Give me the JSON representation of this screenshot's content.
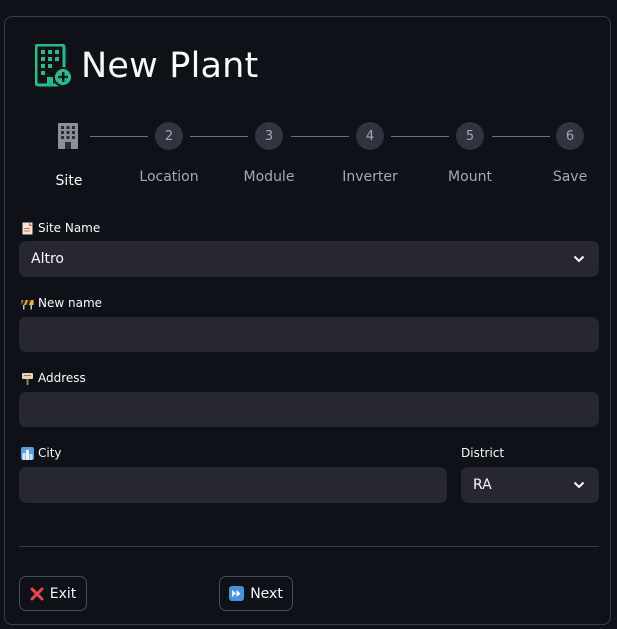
{
  "header": {
    "title": "New Plant",
    "icon": "building-add-icon"
  },
  "stepper": {
    "steps": [
      {
        "number": "",
        "label": "Site",
        "active": true,
        "icon": "building-icon"
      },
      {
        "number": "2",
        "label": "Location"
      },
      {
        "number": "3",
        "label": "Module"
      },
      {
        "number": "4",
        "label": "Inverter"
      },
      {
        "number": "5",
        "label": "Mount"
      },
      {
        "number": "6",
        "label": "Save"
      }
    ]
  },
  "form": {
    "site_name": {
      "label": "Site Name",
      "value": "Altro",
      "icon": "page-icon"
    },
    "new_name": {
      "label": "New name",
      "value": "",
      "icon": "construction-icon"
    },
    "address": {
      "label": "Address",
      "value": "",
      "icon": "signpost-icon"
    },
    "city": {
      "label": "City",
      "value": "",
      "icon": "cityscape-icon"
    },
    "district": {
      "label": "District",
      "value": "RA"
    }
  },
  "buttons": {
    "exit": {
      "label": "Exit",
      "icon": "cross-mark-icon"
    },
    "next": {
      "label": "Next",
      "icon": "fast-forward-icon"
    }
  },
  "colors": {
    "accent": "#21c08b",
    "background": "#0e1117",
    "input": "#262730",
    "circle": "#31333f"
  }
}
